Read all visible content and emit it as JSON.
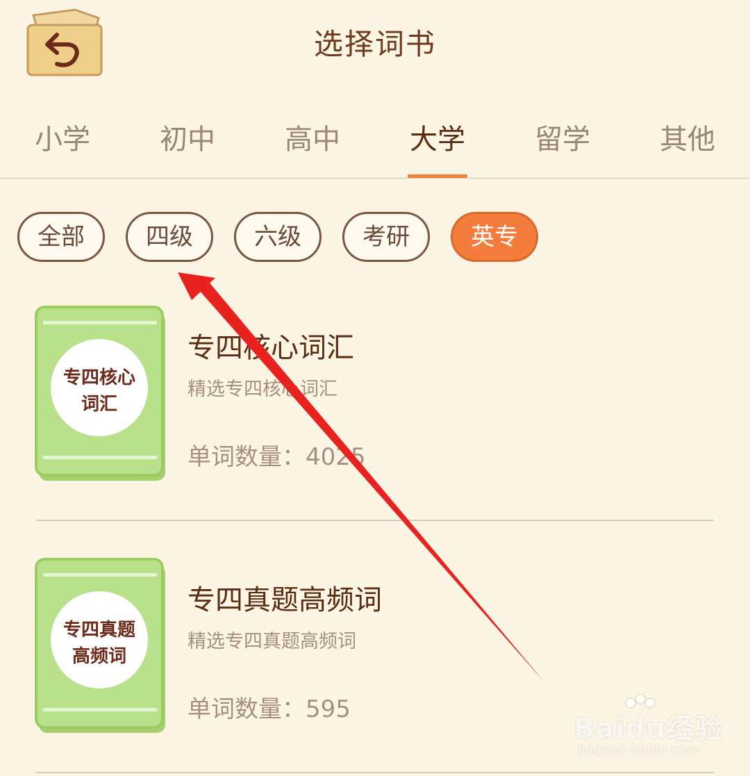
{
  "header": {
    "title": "选择词书",
    "back_icon": "back-arrow-folder-icon"
  },
  "tabs": [
    {
      "label": "小学",
      "active": false
    },
    {
      "label": "初中",
      "active": false
    },
    {
      "label": "高中",
      "active": false
    },
    {
      "label": "大学",
      "active": true
    },
    {
      "label": "留学",
      "active": false
    },
    {
      "label": "其他",
      "active": false
    }
  ],
  "filters": [
    {
      "label": "全部",
      "active": false
    },
    {
      "label": "四级",
      "active": false
    },
    {
      "label": "六级",
      "active": false
    },
    {
      "label": "考研",
      "active": false
    },
    {
      "label": "英专",
      "active": true
    }
  ],
  "books": [
    {
      "title": "专四核心词汇",
      "description": "精选专四核心词汇",
      "count_text": "单词数量：4025",
      "cover_line1": "专四核心",
      "cover_line2": "词汇"
    },
    {
      "title": "专四真题高频词",
      "description": "精选专四真题高频词",
      "count_text": "单词数量：595",
      "cover_line1": "专四真题",
      "cover_line2": "高频词"
    }
  ],
  "colors": {
    "background": "#fdf5e3",
    "accent": "#f47c3c",
    "active_tab_indicator": "#f0823c",
    "book_cover": "#b9e08a",
    "annotation_arrow": "#e8221f"
  },
  "watermark": {
    "brand": "Baidu经验",
    "url": "jingyan.baidu.com"
  }
}
